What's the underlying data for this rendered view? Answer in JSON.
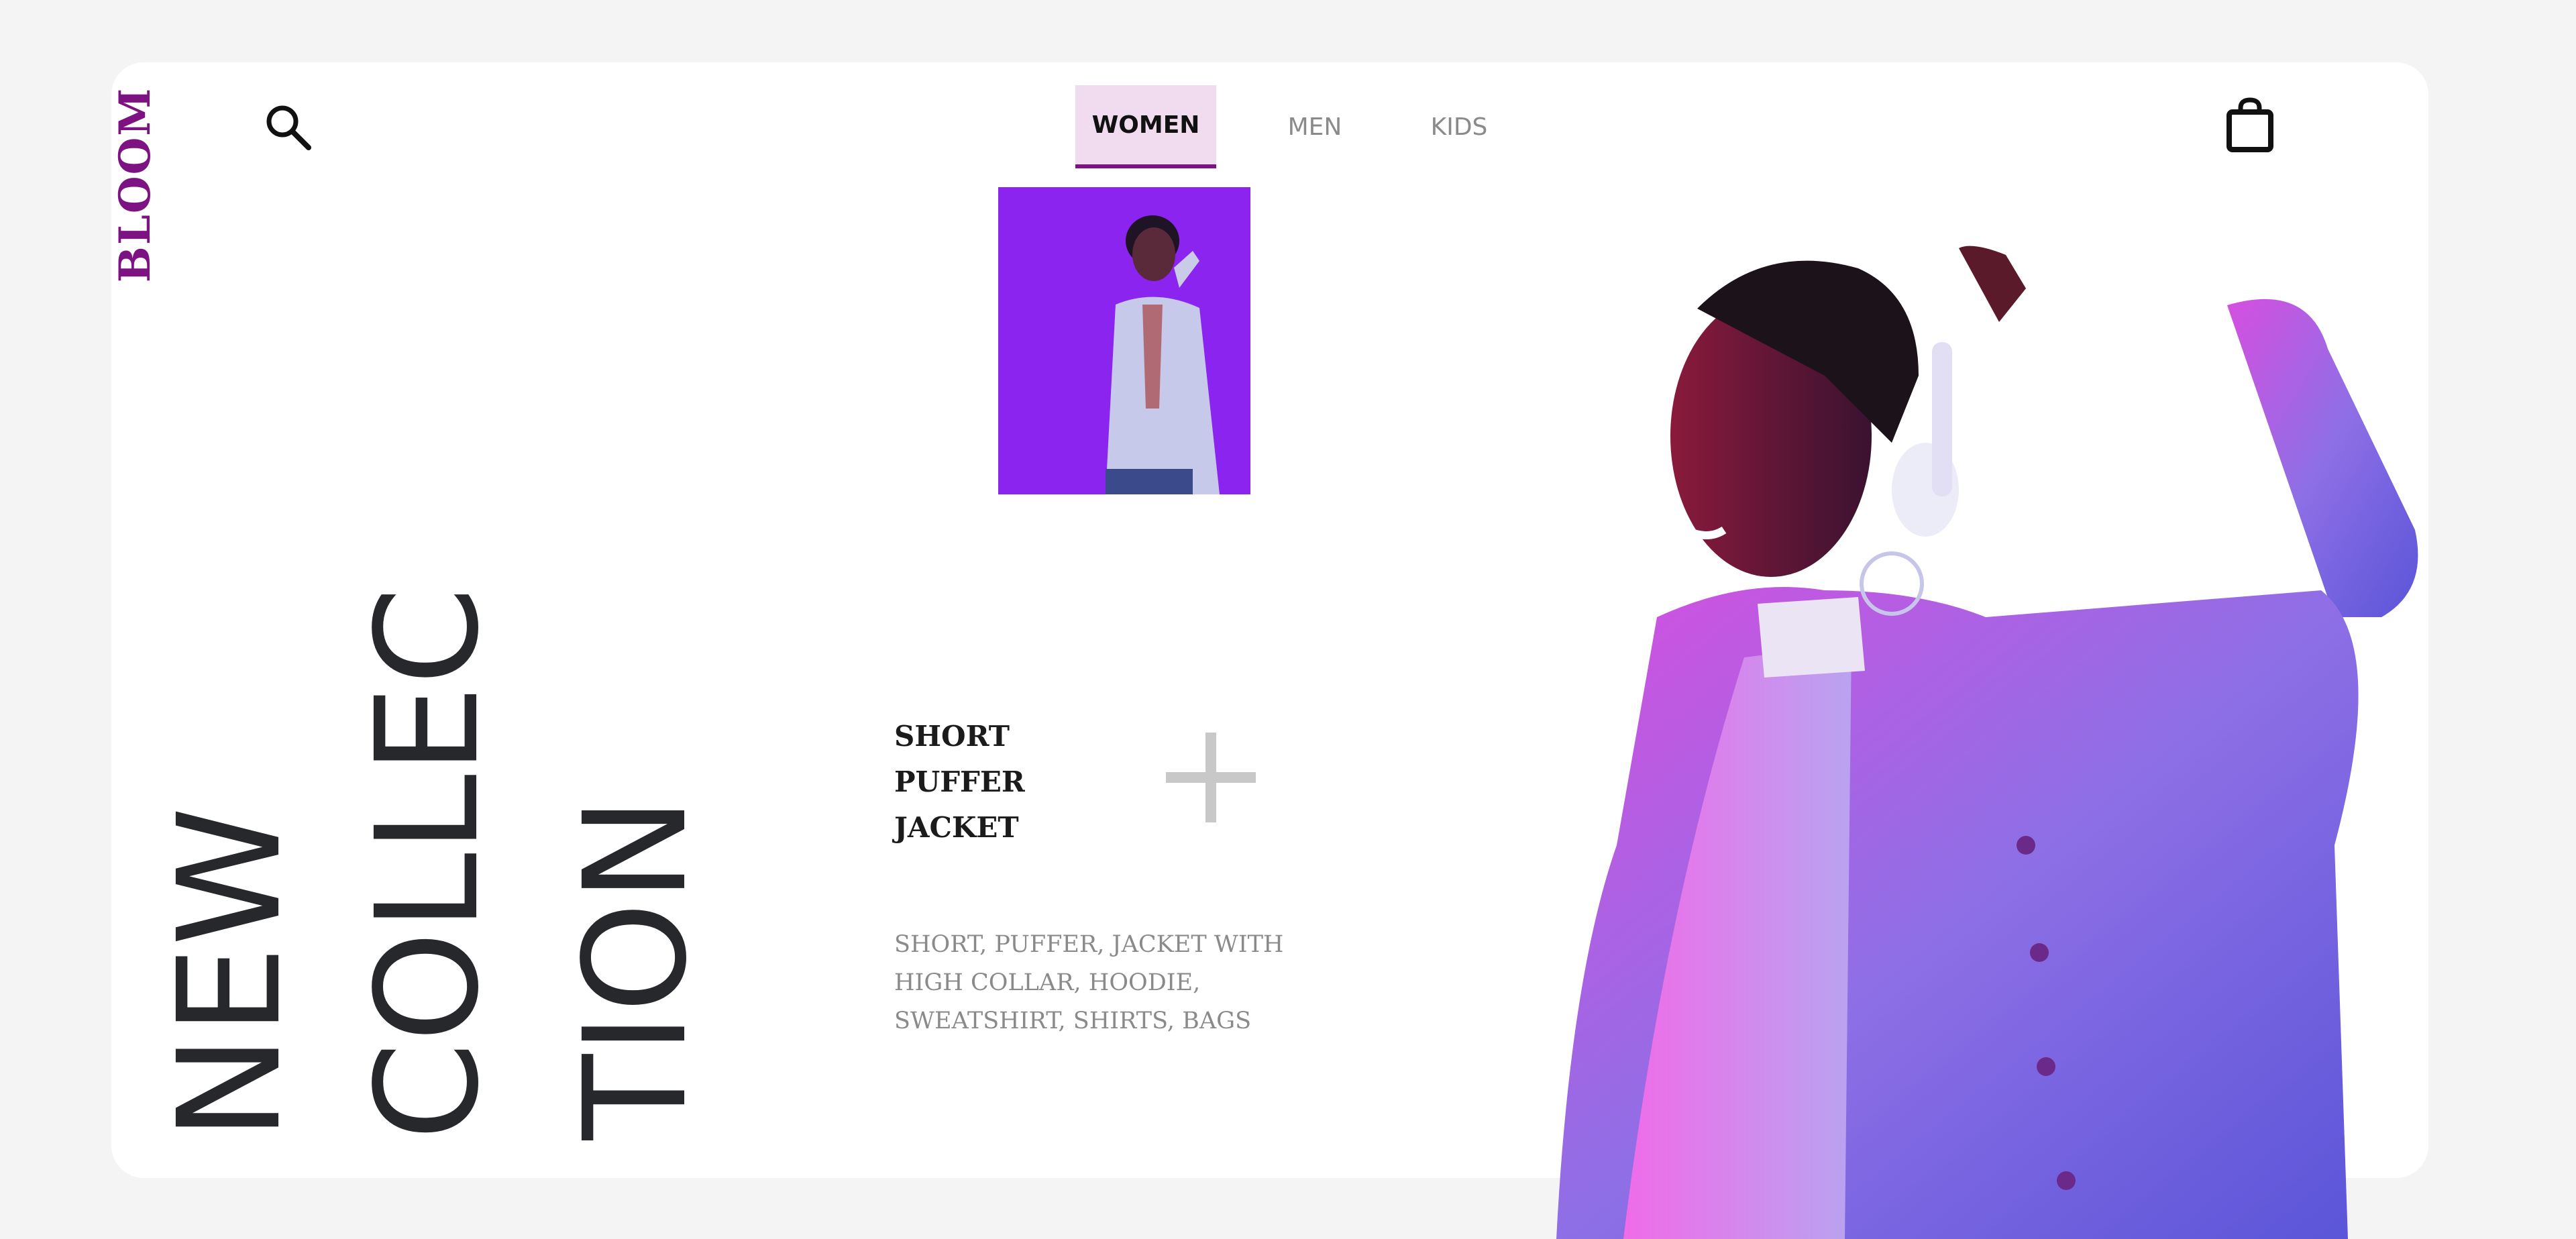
{
  "brand": {
    "name": "BLOOM",
    "color": "#7d1282"
  },
  "header": {
    "search_icon": "search-icon",
    "cart_icon": "shopping-bag-icon",
    "nav": [
      {
        "label": "WOMEN",
        "active": true
      },
      {
        "label": "MEN",
        "active": false
      },
      {
        "label": "KIDS",
        "active": false
      }
    ]
  },
  "hero": {
    "headline_lines": [
      "NEW",
      "COLLEC",
      "TION"
    ]
  },
  "product": {
    "title_lines": [
      "SHORT",
      "PUFFER",
      "JACKET"
    ],
    "description_lines": [
      "SHORT, PUFFER, JACKET WITH",
      "HIGH COLLAR, HOODIE,",
      "SWEATSHIRT, SHIRTS, BAGS"
    ],
    "expand_icon": "plus-icon"
  },
  "colors": {
    "page_background": "#f4f4f4",
    "card_background": "#ffffff",
    "active_tab_background": "#f0dcee",
    "thumbnail_background": "#8b24ef",
    "text_dark": "#1b1b1b",
    "text_muted": "#8a8a8a"
  }
}
